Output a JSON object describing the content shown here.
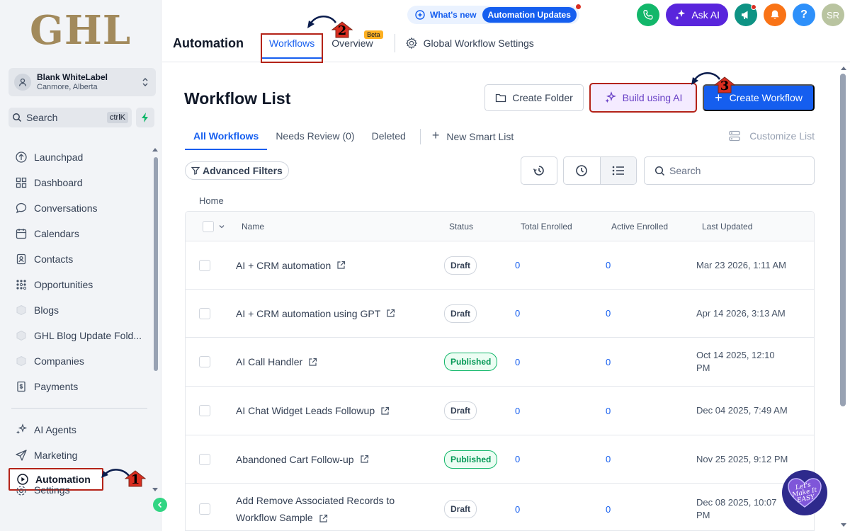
{
  "sidebar": {
    "logo": "GHL",
    "location": {
      "name": "Blank WhiteLabel",
      "address": "Canmore, Alberta"
    },
    "search": {
      "label": "Search",
      "shortcut": "ctrlK"
    },
    "items": [
      {
        "label": "Launchpad",
        "icon": "rocket-icon"
      },
      {
        "label": "Dashboard",
        "icon": "grid-icon"
      },
      {
        "label": "Conversations",
        "icon": "chat-icon"
      },
      {
        "label": "Calendars",
        "icon": "calendar-icon"
      },
      {
        "label": "Contacts",
        "icon": "contacts-icon"
      },
      {
        "label": "Opportunities",
        "icon": "funnel-icon"
      },
      {
        "label": "Blogs",
        "icon": "cube-icon"
      },
      {
        "label": "GHL Blog Update Fold...",
        "icon": "cube-icon"
      },
      {
        "label": "Companies",
        "icon": "cube-icon"
      },
      {
        "label": "Payments",
        "icon": "invoice-icon"
      }
    ],
    "items2": [
      {
        "label": "AI Agents",
        "icon": "sparkle-icon"
      },
      {
        "label": "Marketing",
        "icon": "send-icon"
      },
      {
        "label": "Automation",
        "icon": "play-icon"
      },
      {
        "label": "Settings",
        "icon": "gear-icon"
      }
    ]
  },
  "topbar": {
    "whats_new": "What's new",
    "updates_pill": "Automation Updates",
    "ask_ai": "Ask AI",
    "avatar": "SR",
    "app_title": "Automation",
    "tabs": {
      "workflows": "Workflows",
      "overview": "Overview",
      "beta": "Beta",
      "global": "Global Workflow Settings"
    }
  },
  "main": {
    "title": "Workflow List",
    "buttons": {
      "create_folder": "Create Folder",
      "build_ai": "Build using AI",
      "create_workflow": "Create Workflow"
    },
    "subtabs": {
      "all": "All Workflows",
      "review": "Needs Review (0)",
      "deleted": "Deleted",
      "smart": "New Smart List",
      "customize": "Customize List"
    },
    "filters": "Advanced Filters",
    "search_placeholder": "Search",
    "breadcrumb": "Home",
    "columns": {
      "name": "Name",
      "status": "Status",
      "total": "Total Enrolled",
      "active": "Active Enrolled",
      "updated": "Last Updated"
    },
    "rows": [
      {
        "name": "AI + CRM automation",
        "status": "Draft",
        "total": "0",
        "active": "0",
        "updated": "Mar 23 2026, 1:11 AM"
      },
      {
        "name": "AI + CRM automation using GPT",
        "status": "Draft",
        "total": "0",
        "active": "0",
        "updated": "Apr 14 2026, 3:13 AM"
      },
      {
        "name": "AI Call Handler",
        "status": "Published",
        "total": "0",
        "active": "0",
        "updated": "Oct 14 2025, 12:10 PM"
      },
      {
        "name": "AI Chat Widget Leads Followup",
        "status": "Draft",
        "total": "0",
        "active": "0",
        "updated": "Dec 04 2025, 7:49 AM"
      },
      {
        "name": "Abandoned Cart Follow-up",
        "status": "Published",
        "total": "0",
        "active": "0",
        "updated": "Nov 25 2025, 9:12 PM"
      },
      {
        "name": "Add Remove Associated Records to Workflow Sample",
        "status": "Draft",
        "total": "0",
        "active": "0",
        "updated": "Dec 08 2025, 10:07 PM"
      }
    ]
  },
  "annotations": {
    "m1": "1",
    "m2": "2",
    "m3": "3",
    "badge_text": "Let's Make It EASY"
  },
  "colors": {
    "primary": "#155eef",
    "highlight": "#b42318",
    "published": "#039855",
    "ai": "#6941c6"
  }
}
